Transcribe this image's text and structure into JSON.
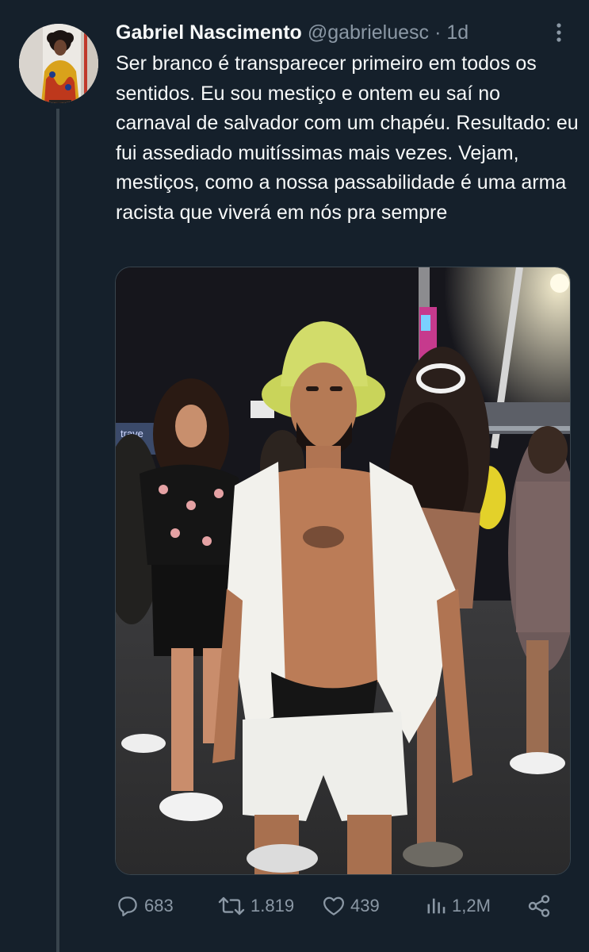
{
  "tweet": {
    "display_name": "Gabriel Nascimento",
    "handle": "@gabrieluesc",
    "separator": "·",
    "time": "1d",
    "text": "Ser branco é transparecer primeiro em todos os sentidos. Eu sou mestiço e ontem eu saí no carnaval de salvador com um chapéu. Resultado: eu fui assediado muitíssimas mais vezes. Vejam, mestiços, como a nossa passabilidade é uma arma racista que viverá em nós pra sempre",
    "media": {
      "description_icon": "photo"
    }
  },
  "actions": {
    "replies": "683",
    "retweets": "1.819",
    "likes": "439",
    "views": "1,2M"
  },
  "colors": {
    "background": "#15202b",
    "text": "#f7f9f9",
    "secondary": "#8b98a5",
    "border": "#38444d"
  },
  "icons": [
    "more-icon",
    "reply-icon",
    "retweet-icon",
    "like-icon",
    "views-icon",
    "share-icon"
  ]
}
